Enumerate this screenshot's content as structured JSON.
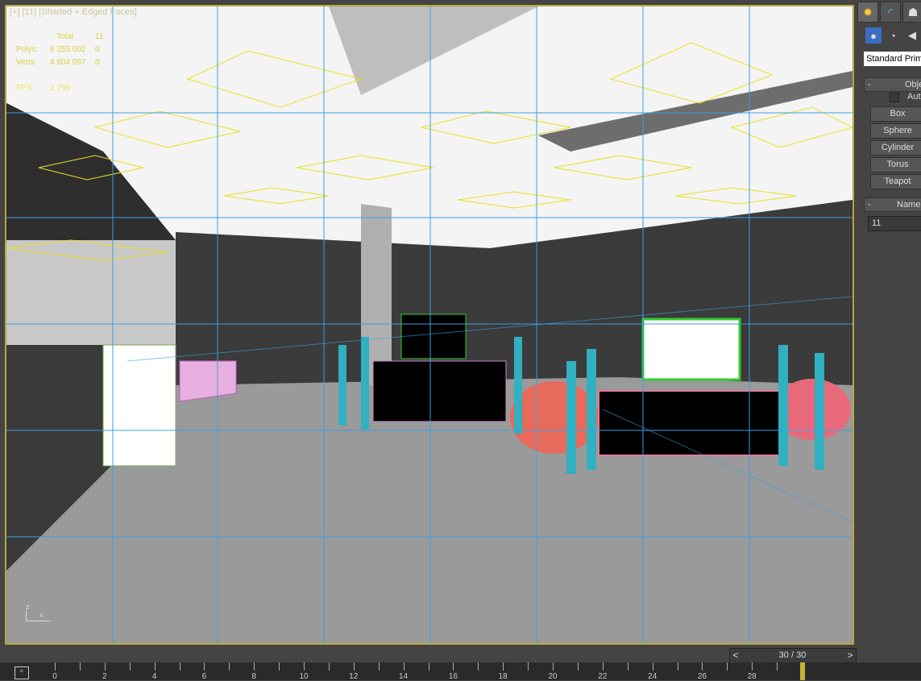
{
  "viewport": {
    "label": "[+] [11] [Shaded + Edged Faces]",
    "stats": {
      "header_total": "Total",
      "header_sel": "11",
      "polys_label": "Polys:",
      "polys_total": "6 255 002",
      "polys_sel": "0",
      "verts_label": "Verts:",
      "verts_total": "4 604 097",
      "verts_sel": "0",
      "fps_label": "FPS:",
      "fps_value": "2,799"
    },
    "axis_z": "z",
    "axis_x": "x"
  },
  "command_panel": {
    "tabs": [
      "create-icon",
      "modify-icon",
      "hierarchy-icon"
    ],
    "subtabs": [
      "geometry-icon",
      "shapes-icon",
      "lights-icon"
    ],
    "category": "Standard Primitives",
    "object_type_title": "Object Type",
    "autogrid_label": "AutoGrid",
    "buttons": [
      "Box",
      "Sphere",
      "Cylinder",
      "Torus",
      "Teapot"
    ],
    "name_color_title": "Name and Color",
    "name_value": "11"
  },
  "timeline": {
    "frame_display": "30 / 30",
    "prev": "<",
    "next": ">",
    "current_frame": 30,
    "total_frames": 30,
    "labels": [
      "0",
      "2",
      "4",
      "6",
      "8",
      "10",
      "12",
      "14",
      "16",
      "18",
      "20",
      "22",
      "24",
      "26",
      "28"
    ]
  },
  "colors": {
    "accent": "#b8a640",
    "grid": "#3aa0e0",
    "lights": "#e8e020"
  }
}
